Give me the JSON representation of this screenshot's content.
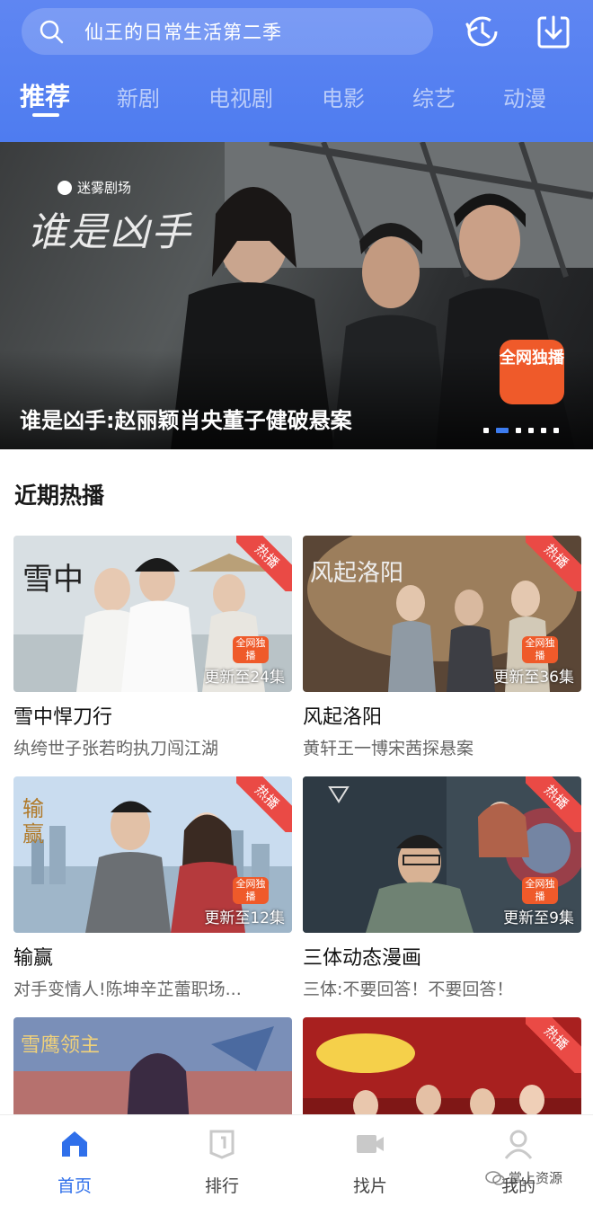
{
  "colors": {
    "header": "#4e7cf0",
    "accent": "#2f6fea",
    "hot": "#ea4a45",
    "exclusive": "#ef5a2a"
  },
  "search": {
    "value": "仙王的日常生活第二季",
    "icon": "search-icon"
  },
  "header_actions": {
    "history_icon": "history-icon",
    "download_icon": "download-icon"
  },
  "tabs": [
    {
      "label": "推荐",
      "active": true
    },
    {
      "label": "新剧"
    },
    {
      "label": "电视剧"
    },
    {
      "label": "电影"
    },
    {
      "label": "综艺"
    },
    {
      "label": "动漫"
    }
  ],
  "banner": {
    "brand": "迷雾剧场",
    "logo_text": "谁是凶手",
    "badge": "全网独播",
    "title": "谁是凶手:赵丽颖肖央董子健破悬案",
    "slides": 6,
    "active_slide": 2
  },
  "section": {
    "title": "近期热播"
  },
  "cards": [
    {
      "title": "雪中悍刀行",
      "desc": "纨绔世子张若昀执刀闯江湖",
      "episode": "更新至24集",
      "hot": "热播",
      "badge": "全网独播"
    },
    {
      "title": "风起洛阳",
      "desc": "黄轩王一博宋茜探悬案",
      "episode": "更新至36集",
      "hot": "热播",
      "badge": "全网独播"
    },
    {
      "title": "输赢",
      "desc": "对手变情人!陈坤辛芷蕾职场...",
      "episode": "更新至12集",
      "hot": "热播",
      "badge": "全网独播"
    },
    {
      "title": "三体动态漫画",
      "desc": "三体:不要回答！不要回答！",
      "episode": "更新至9集",
      "hot": "热播",
      "badge": "全网独播"
    },
    {
      "title": "",
      "desc": "",
      "episode": "",
      "hot": ""
    },
    {
      "title": "",
      "desc": "",
      "episode": "",
      "hot": "热播"
    }
  ],
  "bottom_nav": [
    {
      "label": "首页",
      "icon": "home-icon",
      "active": true
    },
    {
      "label": "排行",
      "icon": "ranking-icon"
    },
    {
      "label": "找片",
      "icon": "video-icon"
    },
    {
      "label": "我的",
      "icon": "user-icon"
    }
  ],
  "watermark": "掌上资源"
}
